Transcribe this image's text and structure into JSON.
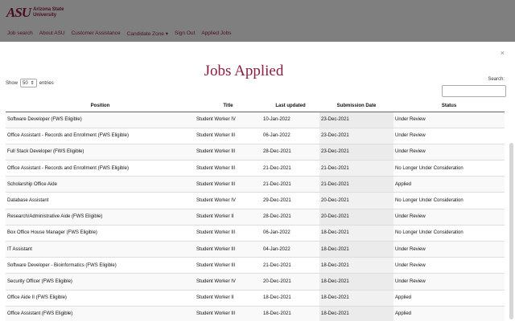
{
  "site": {
    "logo_mark": "ASU",
    "logo_text": "Arizona State University",
    "nav": [
      "Job search",
      "About ASU",
      "Customer Assistance",
      "Candidate Zone",
      "Sign Out",
      "Applied Jobs"
    ]
  },
  "modal": {
    "close_label": "×",
    "title": "Jobs Applied",
    "show_label": "Show",
    "show_value": "50",
    "entries_label": "entries",
    "search_label": "Search:"
  },
  "table": {
    "headers": [
      "Position",
      "Title",
      "Last updated",
      "Submission Date",
      "Status"
    ],
    "rows": [
      [
        "Software Developer (FWS Eligible)",
        "Student Worker IV",
        "10-Jan-2022",
        "23-Dec-2021",
        "Under Review"
      ],
      [
        "Office Assistant - Records and Enrollment (FWS Eligible)",
        "Student Worker III",
        "06-Jan-2022",
        "23-Dec-2021",
        "Under Review"
      ],
      [
        "Full Stack Developer (FWS Eligible)",
        "Student Worker III",
        "28-Dec-2021",
        "23-Dec-2021",
        "Under Review"
      ],
      [
        "Office Assistant - Records and Enrollment (FWS Eligible)",
        "Student Worker III",
        "21-Dec-2021",
        "21-Dec-2021",
        "No Longer Under Consideration"
      ],
      [
        "Scholarship Office Aide",
        "Student Worker III",
        "21-Dec-2021",
        "21-Dec-2021",
        "Applied"
      ],
      [
        "Database Assistant",
        "Student Worker IV",
        "29-Dec-2021",
        "20-Dec-2021",
        "No Longer Under Consideration"
      ],
      [
        "Research/Administrative Aide (FWS Eligible)",
        "Student Worker II",
        "28-Dec-2021",
        "20-Dec-2021",
        "Under Review"
      ],
      [
        "Box Office House Manager (FWS Eligible)",
        "Student Worker III",
        "06-Jan-2022",
        "18-Dec-2021",
        "No Longer Under Consideration"
      ],
      [
        "IT Assistant",
        "Student Worker III",
        "04-Jan-2022",
        "18-Dec-2021",
        "Under Review"
      ],
      [
        "Software Developer - Bioinformatics (FWS Eligible)",
        "Student Worker III",
        "21-Dec-2021",
        "18-Dec-2021",
        "Under Review"
      ],
      [
        "Security Officer (FWS Eligible)",
        "Student Worker IV",
        "20-Dec-2021",
        "18-Dec-2021",
        "Under Review"
      ],
      [
        "Office Aide II (FWS Eligible)",
        "Student Worker II",
        "18-Dec-2021",
        "18-Dec-2021",
        "Applied"
      ],
      [
        "Office Assistant (FWS Eligible)",
        "Student Worker III",
        "18-Dec-2021",
        "18-Dec-2021",
        "Applied"
      ]
    ]
  }
}
